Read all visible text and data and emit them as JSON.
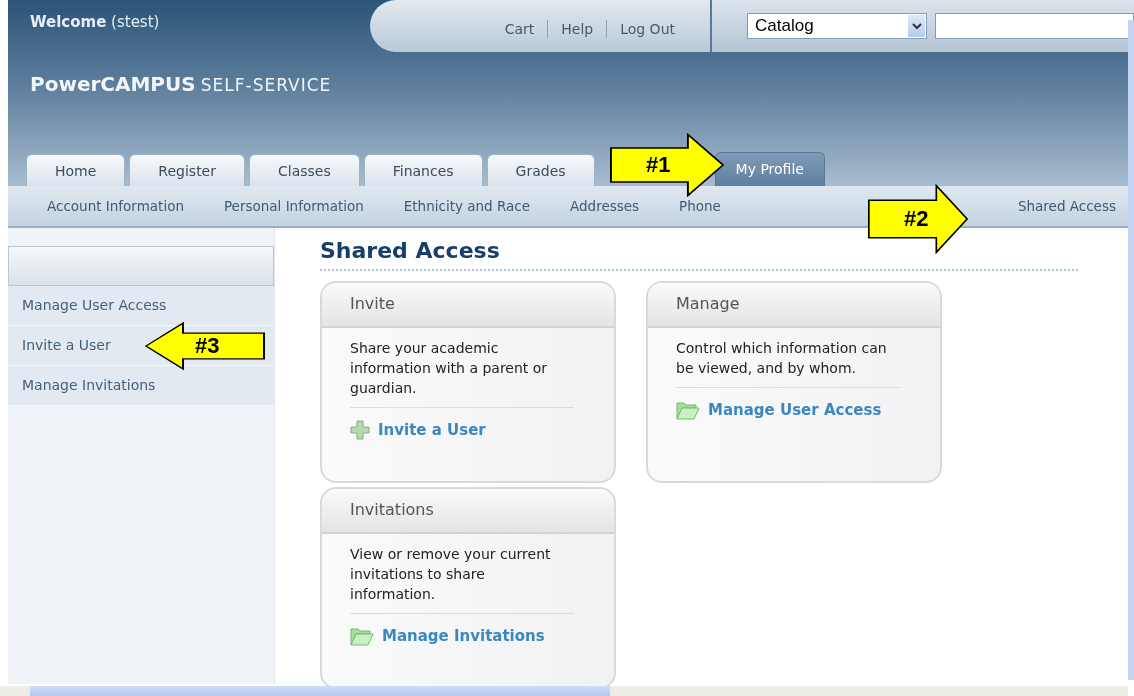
{
  "header": {
    "welcome": "Welcome",
    "user": "(stest)",
    "logo_main": "PowerCAMPUS",
    "logo_sub": "SELF-SERVICE",
    "links": [
      "Cart",
      "Help",
      "Log Out"
    ],
    "search_scope": "Catalog"
  },
  "tabs": [
    {
      "label": "Home",
      "selected": false
    },
    {
      "label": "Register",
      "selected": false
    },
    {
      "label": "Classes",
      "selected": false
    },
    {
      "label": "Finances",
      "selected": false
    },
    {
      "label": "Grades",
      "selected": false
    },
    {
      "label": "My Profile",
      "selected": true
    }
  ],
  "subnav": [
    "Account Information",
    "Personal Information",
    "Ethnicity and Race",
    "Addresses",
    "Phone",
    "Shared Access"
  ],
  "sidebar": {
    "items": [
      "Manage User Access",
      "Invite a User",
      "Manage Invitations"
    ]
  },
  "main": {
    "title": "Shared Access",
    "cards": [
      {
        "title": "Invite",
        "text": "Share your academic information with a parent or guardian.",
        "link": "Invite a User",
        "kind": "add"
      },
      {
        "title": "Manage",
        "text": "Control which information can be viewed, and by whom.",
        "link": "Manage User Access",
        "kind": "folder"
      },
      {
        "title": "Invitations",
        "text": "View or remove your current invitations to share information.",
        "link": "Manage Invitations",
        "kind": "folder"
      }
    ]
  },
  "callouts": [
    {
      "label": "#1",
      "kind": "right"
    },
    {
      "label": "#2",
      "kind": "right"
    },
    {
      "label": "#3",
      "kind": "left"
    }
  ]
}
